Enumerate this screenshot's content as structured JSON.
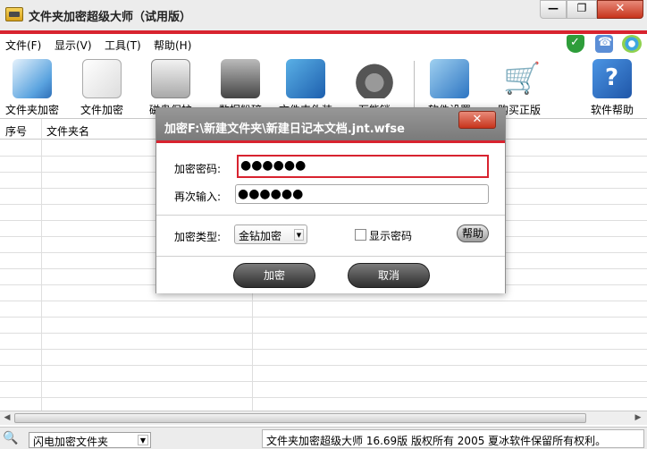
{
  "window": {
    "title": "文件夹加密超级大师（试用版）",
    "minimize_glyph": "—",
    "maximize_glyph": "❐",
    "close_glyph": "✕"
  },
  "menu": {
    "items": [
      {
        "label": "文件(F)"
      },
      {
        "label": "显示(V)"
      },
      {
        "label": "工具(T)"
      },
      {
        "label": "帮助(H)"
      }
    ]
  },
  "toolbar": {
    "items": [
      {
        "label": "文件夹加密",
        "icon": "folder-encrypt-icon"
      },
      {
        "label": "文件加密",
        "icon": "file-encrypt-icon"
      },
      {
        "label": "磁盘保护",
        "icon": "disk-protect-icon"
      },
      {
        "label": "数据粉碎",
        "icon": "data-shred-icon"
      },
      {
        "label": "文件夹伪装",
        "icon": "folder-disguise-icon"
      },
      {
        "label": "万能锁",
        "icon": "lock-icon"
      },
      {
        "label": "软件设置",
        "icon": "settings-icon"
      },
      {
        "label": "购买正版",
        "icon": "cart-icon"
      },
      {
        "label": "软件帮助",
        "icon": "help-icon"
      }
    ]
  },
  "list": {
    "columns": [
      "序号",
      "文件夹名"
    ]
  },
  "statusbar": {
    "mode": "闪电加密文件夹",
    "copyright": "文件夹加密超级大师 16.69版 版权所有 2005 夏冰软件保留所有权利。"
  },
  "dialog": {
    "title": "加密F:\\新建文件夹\\新建日记本文档.jnt.wfse",
    "close_glyph": "✕",
    "password_label": "加密密码:",
    "password_value": "●●●●●●",
    "confirm_label": "再次输入:",
    "confirm_value": "●●●●●●",
    "type_label": "加密类型:",
    "type_value": "金钻加密",
    "show_password_label": "显示密码",
    "help_label": "帮助",
    "ok_label": "加密",
    "cancel_label": "取消"
  }
}
